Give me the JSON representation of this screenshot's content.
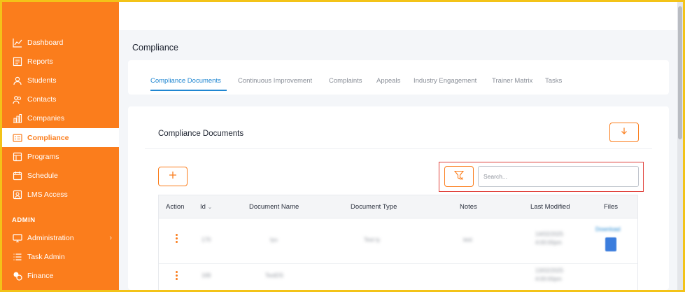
{
  "sidebar": {
    "items": [
      {
        "label": "Dashboard",
        "icon": "chart-line-icon"
      },
      {
        "label": "Reports",
        "icon": "report-icon"
      },
      {
        "label": "Students",
        "icon": "students-icon"
      },
      {
        "label": "Contacts",
        "icon": "contacts-icon"
      },
      {
        "label": "Companies",
        "icon": "companies-icon"
      },
      {
        "label": "Compliance",
        "icon": "compliance-icon",
        "active": true
      },
      {
        "label": "Programs",
        "icon": "programs-icon"
      },
      {
        "label": "Schedule",
        "icon": "calendar-icon"
      },
      {
        "label": "LMS Access",
        "icon": "lms-icon"
      }
    ],
    "admin_label": "ADMIN",
    "admin_items": [
      {
        "label": "Administration",
        "icon": "administration-icon"
      },
      {
        "label": "Task Admin",
        "icon": "task-list-icon"
      },
      {
        "label": "Finance",
        "icon": "finance-icon"
      }
    ]
  },
  "page": {
    "title": "Compliance"
  },
  "tabs": [
    {
      "label": "Compliance Documents",
      "active": true
    },
    {
      "label": "Continuous Improvement"
    },
    {
      "label": "Complaints"
    },
    {
      "label": "Appeals"
    },
    {
      "label": "Industry Engagement"
    },
    {
      "label": "Trainer Matrix"
    },
    {
      "label": "Tasks"
    }
  ],
  "card": {
    "title": "Compliance Documents"
  },
  "search": {
    "placeholder": "Search..."
  },
  "table": {
    "headers": {
      "action": "Action",
      "id": "Id",
      "document_name": "Document Name",
      "document_type": "Document Type",
      "notes": "Notes",
      "last_modified": "Last Modified",
      "files": "Files"
    },
    "rows": [
      {
        "id": "170",
        "document_name": "tyu",
        "document_type": "Test ty",
        "notes": "test",
        "last_modified_date": "14/02/2025",
        "last_modified_time": "4:00:00pm",
        "file_link": "Download"
      },
      {
        "id": "169",
        "document_name": "TestDS",
        "document_type": "",
        "notes": "",
        "last_modified_date": "13/02/2025",
        "last_modified_time": "4:00:00pm",
        "file_link": ""
      }
    ]
  },
  "colors": {
    "brand": "#fb7d1c",
    "accent": "#1f86d1",
    "highlight": "#e0423c"
  }
}
